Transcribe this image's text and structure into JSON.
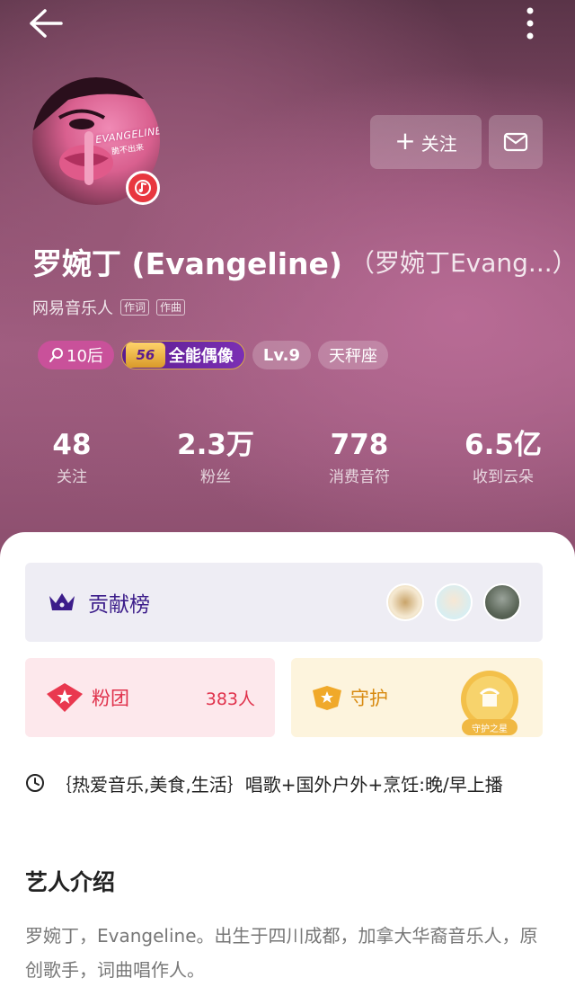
{
  "header": {
    "back_icon": "arrow-left-icon",
    "more_icon": "more-vertical-icon"
  },
  "profile": {
    "avatar_text": "EVANGELINE",
    "avatar_subtext": "脆不出来",
    "music_badge_icon": "music-note-icon",
    "follow_label": "关注",
    "name": "罗婉丁 (Evangeline)",
    "alias": "（罗婉丁Evang...）",
    "role": "网易音乐人",
    "role_tags": [
      "作词",
      "作曲"
    ],
    "badges": {
      "age": "10后",
      "idol_level": "56",
      "idol": "全能偶像",
      "level": "Lv.9",
      "zodiac": "天秤座"
    }
  },
  "stats": [
    {
      "value": "48",
      "label": "关注"
    },
    {
      "value": "2.3万",
      "label": "粉丝"
    },
    {
      "value": "778",
      "label": "消费音符"
    },
    {
      "value": "6.5亿",
      "label": "收到云朵"
    }
  ],
  "contribution": {
    "title": "贡献榜",
    "icon": "crown-icon"
  },
  "fan_group": {
    "title": "粉团",
    "count": "383人",
    "icon": "diamond-star-icon"
  },
  "guard": {
    "title": "守护",
    "medal_label": "守护之星",
    "icon": "shield-star-icon"
  },
  "live_schedule": {
    "icon": "clock-icon",
    "text": "｛热爱音乐,美食,生活｝唱歌+国外户外+烹饪:晚/早上播"
  },
  "intro": {
    "title": "艺人介绍",
    "body": "罗婉丁，Evangeline。出生于四川成都，加拿大华裔音乐人，原创歌手，词曲唱作人。"
  },
  "colors": {
    "fan_accent": "#e0314b",
    "guard_accent": "#d88a10",
    "rank_accent": "#3c1d8a"
  }
}
